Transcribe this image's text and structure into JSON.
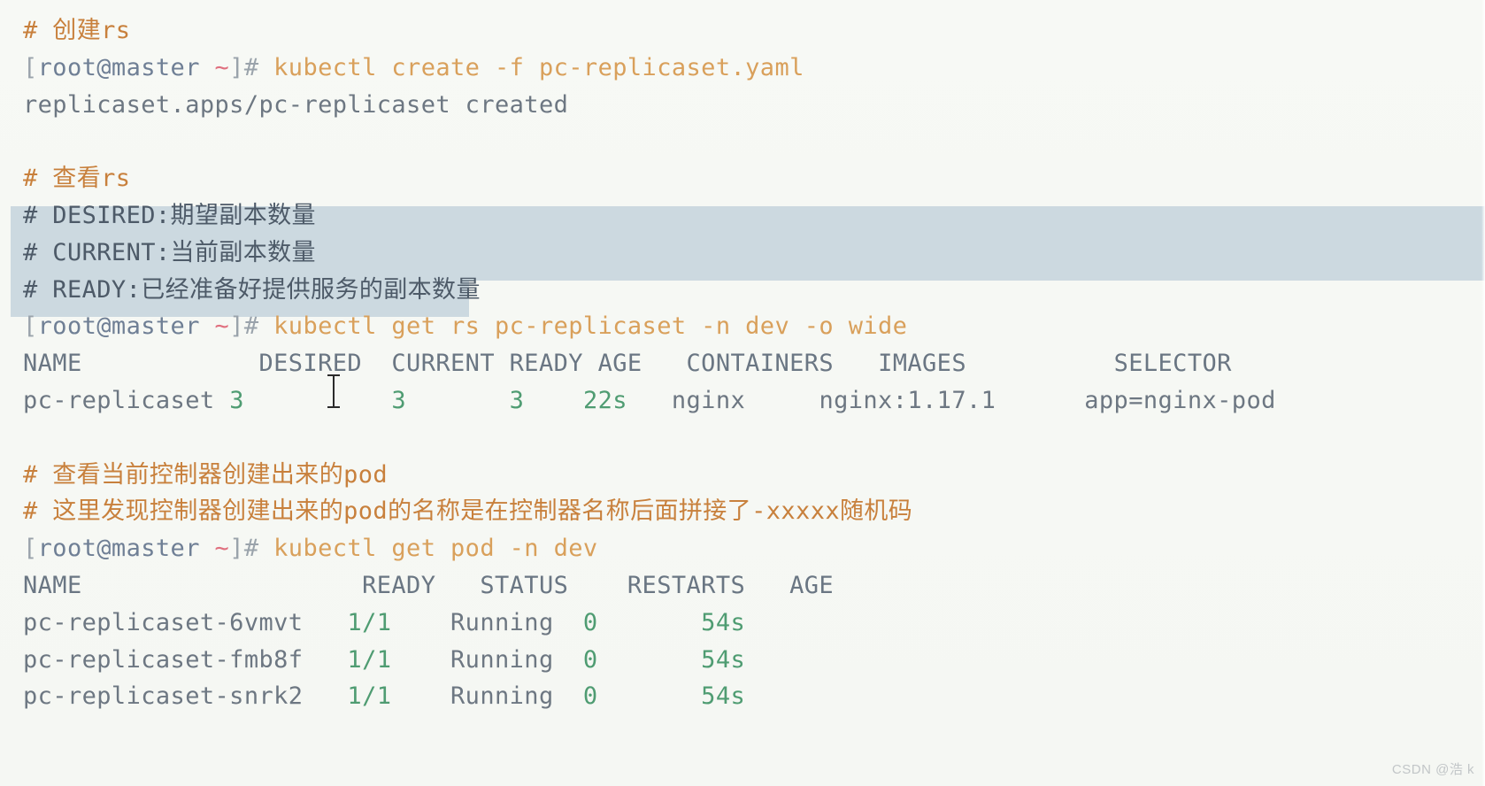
{
  "terminal": {
    "prompt": {
      "open_bracket": "[",
      "user_host": "root@master",
      "tilde": "~",
      "close": "]#"
    },
    "lines": [
      {
        "id": "comment-create-rs",
        "kind": "comment",
        "text": "# 创建rs"
      },
      {
        "id": "cmd-create",
        "kind": "command",
        "command": "kubectl create -f pc-replicaset.yaml"
      },
      {
        "id": "out-created",
        "kind": "output",
        "text": "replicaset.apps/pc-replicaset created"
      },
      {
        "id": "blank-1",
        "kind": "blank",
        "text": " "
      },
      {
        "id": "comment-view-rs",
        "kind": "comment",
        "text": "# 查看rs"
      },
      {
        "id": "comment-desired",
        "kind": "comment-selected",
        "text": "# DESIRED:期望副本数量"
      },
      {
        "id": "comment-current",
        "kind": "comment-selected",
        "text": "# CURRENT:当前副本数量"
      },
      {
        "id": "comment-ready",
        "kind": "comment-selected",
        "text": "# READY:已经准备好提供服务的副本数量"
      },
      {
        "id": "cmd-get-rs",
        "kind": "command",
        "command": "kubectl get rs pc-replicaset -n dev -o wide"
      },
      {
        "id": "rs-header",
        "kind": "table-header"
      },
      {
        "id": "rs-row",
        "kind": "table-row"
      },
      {
        "id": "blank-2",
        "kind": "blank",
        "text": " "
      },
      {
        "id": "comment-view-pod",
        "kind": "comment",
        "text": "# 查看当前控制器创建出来的pod"
      },
      {
        "id": "comment-pod-naming",
        "kind": "comment",
        "text": "# 这里发现控制器创建出来的pod的名称是在控制器名称后面拼接了-xxxxx随机码"
      },
      {
        "id": "cmd-get-pod",
        "kind": "command",
        "command": "kubectl get pod -n dev"
      },
      {
        "id": "pod-header",
        "kind": "table-header"
      }
    ],
    "rs_table": {
      "headers": [
        "NAME",
        "DESIRED",
        "CURRENT",
        "READY",
        "AGE",
        "CONTAINERS",
        "IMAGES",
        "SELECTOR"
      ],
      "row": {
        "name": "pc-replicaset",
        "desired": "3",
        "current": "3",
        "ready": "3",
        "age": "22s",
        "containers": "nginx",
        "images": "nginx:1.17.1",
        "selector": "app=nginx-pod"
      }
    },
    "pod_table": {
      "headers": [
        "NAME",
        "READY",
        "STATUS",
        "RESTARTS",
        "AGE"
      ],
      "rows": [
        {
          "name": "pc-replicaset-6vmvt",
          "ready": "1/1",
          "status": "Running",
          "restarts": "0",
          "age": "54s"
        },
        {
          "name": "pc-replicaset-fmb8f",
          "ready": "1/1",
          "status": "Running",
          "restarts": "0",
          "age": "54s"
        },
        {
          "name": "pc-replicaset-snrk2",
          "ready": "1/1",
          "status": "Running",
          "restarts": "0",
          "age": "54s"
        }
      ]
    }
  },
  "watermark": "CSDN @浩 k",
  "colors": {
    "background": "#f6f8f4",
    "comment": "#c8803c",
    "command": "#d9a05b",
    "output": "#6d7782",
    "number": "#4f9c72",
    "selection": "#ccd9e0",
    "prompt_user": "#6f7f95",
    "prompt_tilde": "#e0707f"
  }
}
